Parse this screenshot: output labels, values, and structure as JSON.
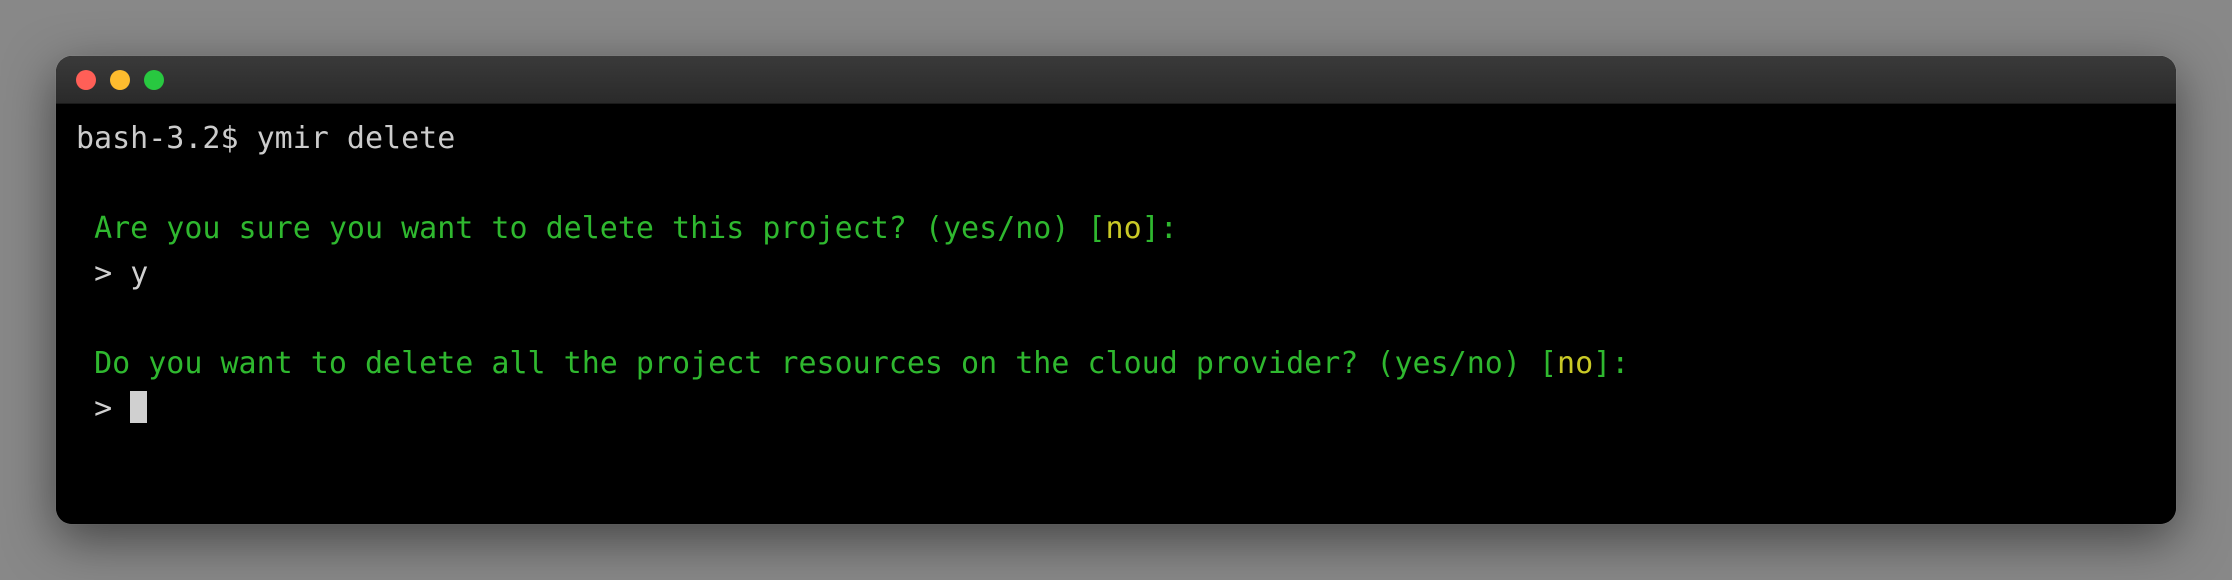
{
  "shell": {
    "prompt": "bash-3.2$ ",
    "command": "ymir delete"
  },
  "dialog1": {
    "question": "Are you sure you want to delete this project? (yes/no) ",
    "bracket_open": "[",
    "default": "no",
    "bracket_close": "]",
    "colon": ":",
    "input_marker": "> ",
    "input_value": "y"
  },
  "dialog2": {
    "question": "Do you want to delete all the project resources on the cloud provider? (yes/no) ",
    "bracket_open": "[",
    "default": "no",
    "bracket_close": "]",
    "colon": ":",
    "input_marker": "> "
  }
}
